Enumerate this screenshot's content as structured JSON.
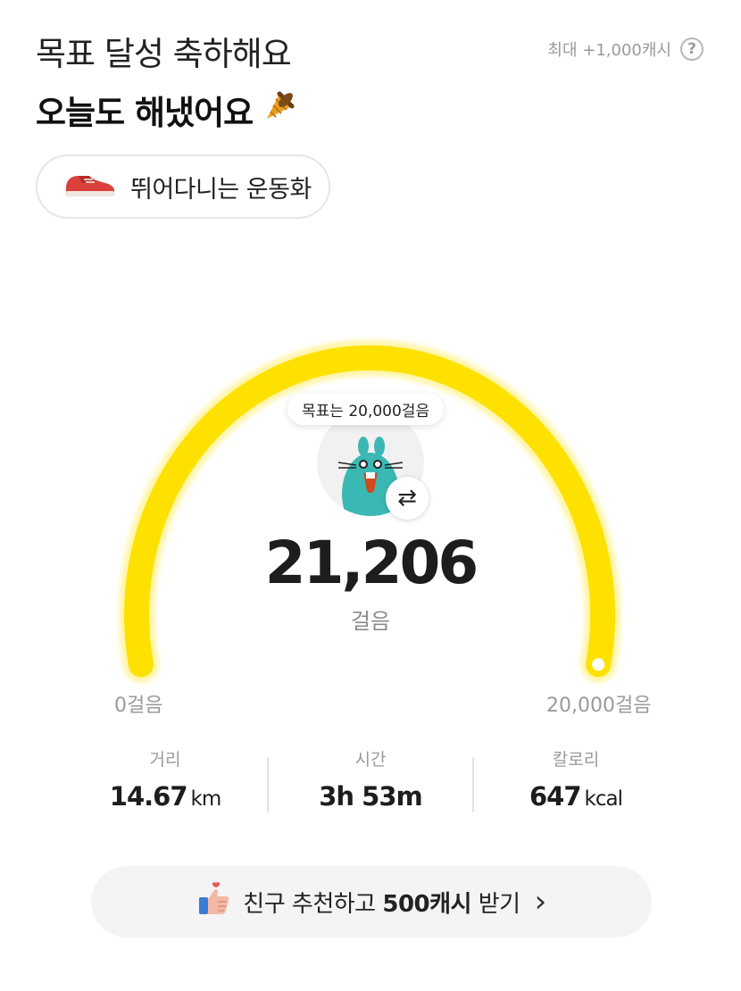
{
  "header": {
    "title_line1": "목표 달성 축하해요",
    "title_line2": "오늘도 해냈어요",
    "title_icon": "party-horn-icon",
    "max_reward": "최대 +1,000캐시",
    "help_symbol": "?"
  },
  "item_chip": {
    "label": "뛰어다니는 운동화",
    "icon": "sneaker-icon"
  },
  "gauge": {
    "goal_tooltip": "목표는 20,000걸음",
    "steps": "21,206",
    "steps_value": 21206,
    "goal_value": 20000,
    "steps_unit": "걸음",
    "min_label": "0걸음",
    "max_label": "20,000걸음",
    "arc_color": "#ffe100",
    "mascot": "beaver-mascot-icon",
    "switch_icon": "swap-arrows-icon",
    "switch_symbol": "⇄"
  },
  "stats": {
    "distance": {
      "label": "거리",
      "value": "14.67",
      "unit": "km"
    },
    "time": {
      "label": "시간",
      "value": "3h 53m"
    },
    "calories": {
      "label": "칼로리",
      "value": "647",
      "unit": "kcal"
    }
  },
  "referral": {
    "text_pre": "친구 추천하고 ",
    "text_bold": "500캐시",
    "text_post": " 받기",
    "icon": "thumbs-up-icon",
    "chevron": "›"
  }
}
